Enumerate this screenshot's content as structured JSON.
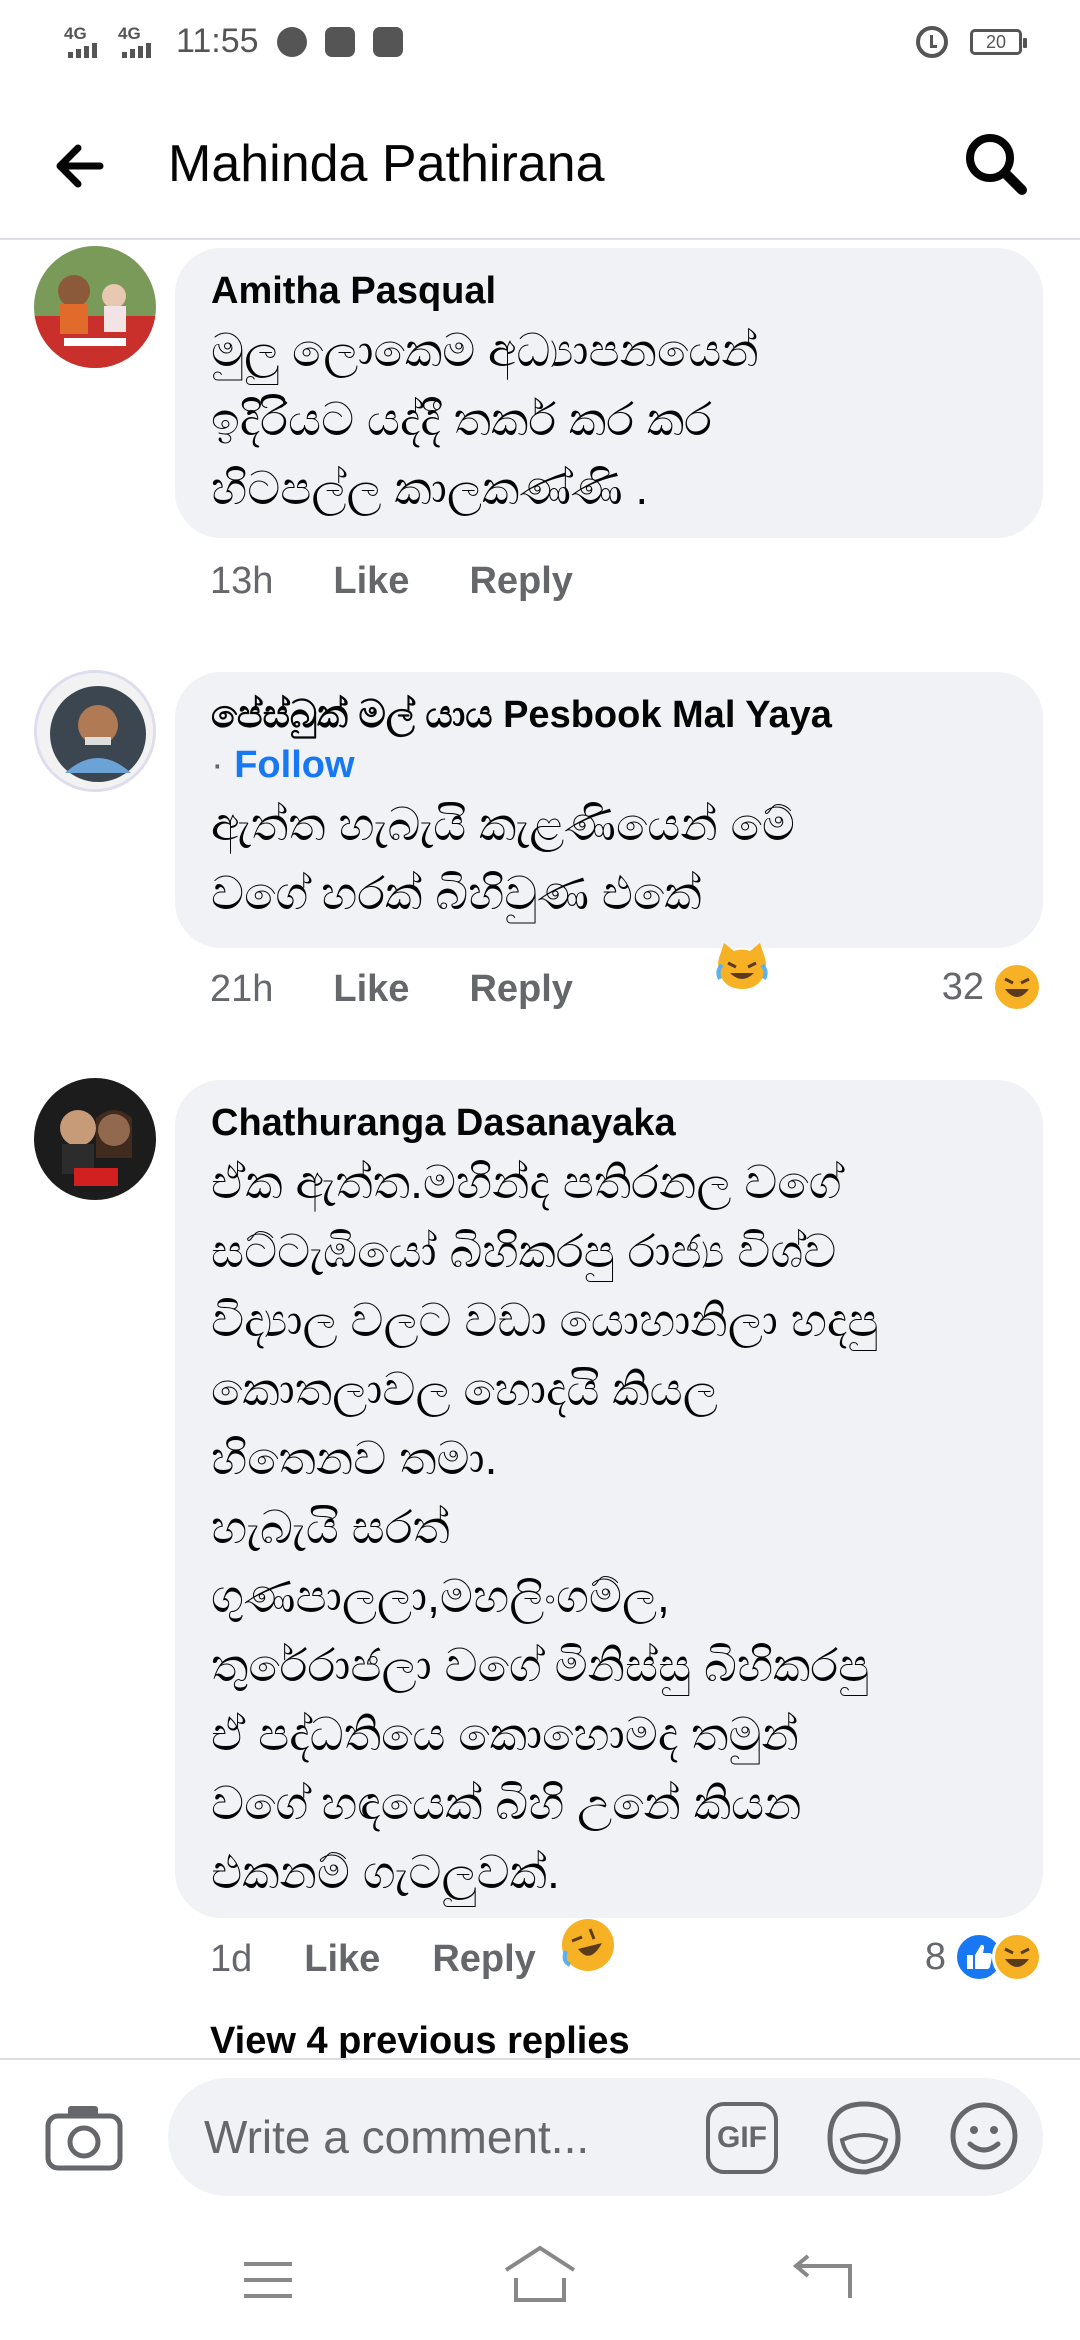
{
  "status_bar": {
    "signal_1": "4G",
    "signal_2": "4G",
    "time": "11:55",
    "battery": "20",
    "icons": [
      "messenger-icon",
      "facebook-icon",
      "inbox-icon",
      "alarm-icon",
      "battery-icon"
    ]
  },
  "header": {
    "title": "Mahinda Pathirana",
    "back_icon": "back-arrow-icon",
    "search_icon": "search-icon"
  },
  "comments": [
    {
      "author": "Amitha Pasqual",
      "text": "මුලු ලොකෙම අධ්‍යාපනයෙන්\nඉදිරියට යද්දී තර්ක කර කර\nහිටපල්ල කාලකණ්ණි .",
      "time": "13h",
      "like_label": "Like",
      "reply_label": "Reply"
    },
    {
      "author": "පේස්බුක් මල් යාය Pesbook Mal Yaya",
      "follow_separator": "·",
      "follow_label": "Follow",
      "text": "ඇත්ත හැබැයි කැළණියෙන් මේ\nවගේ හරක් බිහිවුණ එකේ",
      "time": "21h",
      "like_label": "Like",
      "reply_label": "Reply",
      "reaction_count": "32",
      "reaction_icons": [
        "haha-icon"
      ]
    },
    {
      "author": "Chathuranga Dasanayaka",
      "text": "ඒක ඇත්ත.මහින්ද පතිරනල වගේ\nසට්ටැඹියෝ බිහිකරපු රාජ්‍ය විශ්ව\nවිද්‍යාල වලට වඩා යොහානිලා හදපු\nකොතලාවල හොදයි කියල\nහිතෙනව තමා.\nහැබැයි සරත්\nගුණපාලලා,මහලිංගම්ල,\nතුරේරාජලා වගේ මිනිස්සු බිහිකරපු\nඒ පද්ධතියෙ කොහොමද තමුන්\nවගේ හඳයෙක් බිහි උනේ කියන\nඑකනම් ගැටලුවක්.",
      "time": "1d",
      "like_label": "Like",
      "reply_label": "Reply",
      "reaction_count": "8",
      "reaction_icons": [
        "like-icon",
        "haha-icon"
      ]
    }
  ],
  "view_replies": "View 4 previous replies",
  "composer": {
    "placeholder": "Write a comment...",
    "gif_label": "GIF"
  },
  "colors": {
    "bubble": "#f0f2f5",
    "secondary_text": "#65676b",
    "accent": "#1877f2",
    "haha": "#f7b125"
  }
}
